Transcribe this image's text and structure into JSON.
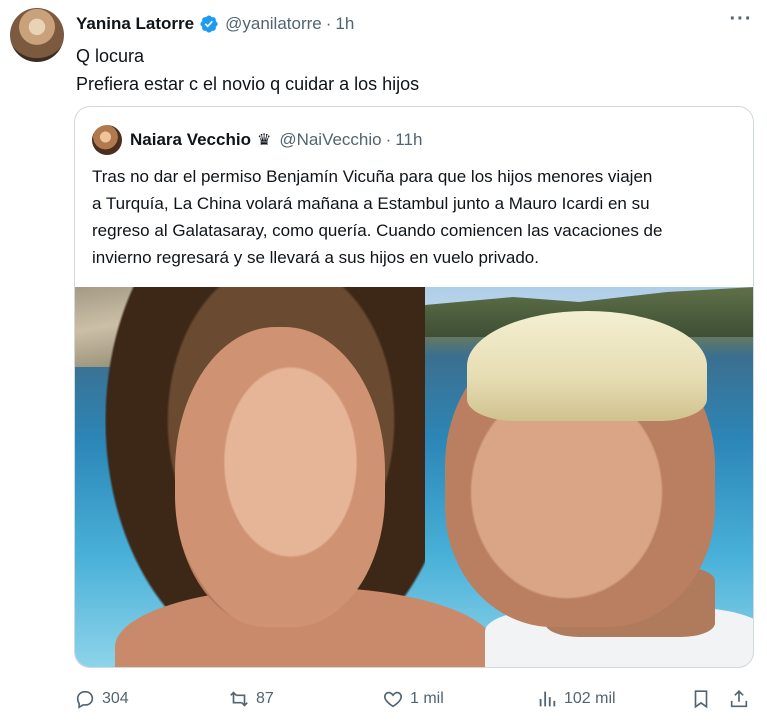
{
  "tweet": {
    "author_name": "Yanina Latorre",
    "author_handle": "@yanilatorre",
    "separator": "·",
    "time": "1h",
    "text_line1": "Q locura",
    "text_line2": "Prefiera estar c el novio q cuidar a los hijos",
    "more_label": "···"
  },
  "quote": {
    "author_name": "Naiara Vecchio",
    "badge": "♛",
    "author_handle": "@NaiVecchio",
    "separator": "·",
    "time": "11h",
    "lines": [
      "Tras no dar el permiso Benjamín Vicuña para que los hijos menores viajen",
      "a Turquía, La China volará mañana a Estambul junto a Mauro Icardi en su",
      "regreso al Galatasaray, como quería. Cuando comiencen las vacaciones de",
      "invierno regresará y se llevará a sus hijos en vuelo privado."
    ]
  },
  "actions": {
    "replies": "304",
    "retweets": "87",
    "likes": "1 mil",
    "views": "102 mil"
  },
  "colors": {
    "text": "#0f1419",
    "muted": "#536471",
    "verified": "#1d9bf0",
    "border": "#cfd9de"
  },
  "icons": [
    "avatar",
    "verified-badge-icon",
    "more-icon",
    "crown-icon",
    "reply-icon",
    "retweet-icon",
    "like-icon",
    "views-icon",
    "bookmark-icon",
    "share-icon"
  ]
}
